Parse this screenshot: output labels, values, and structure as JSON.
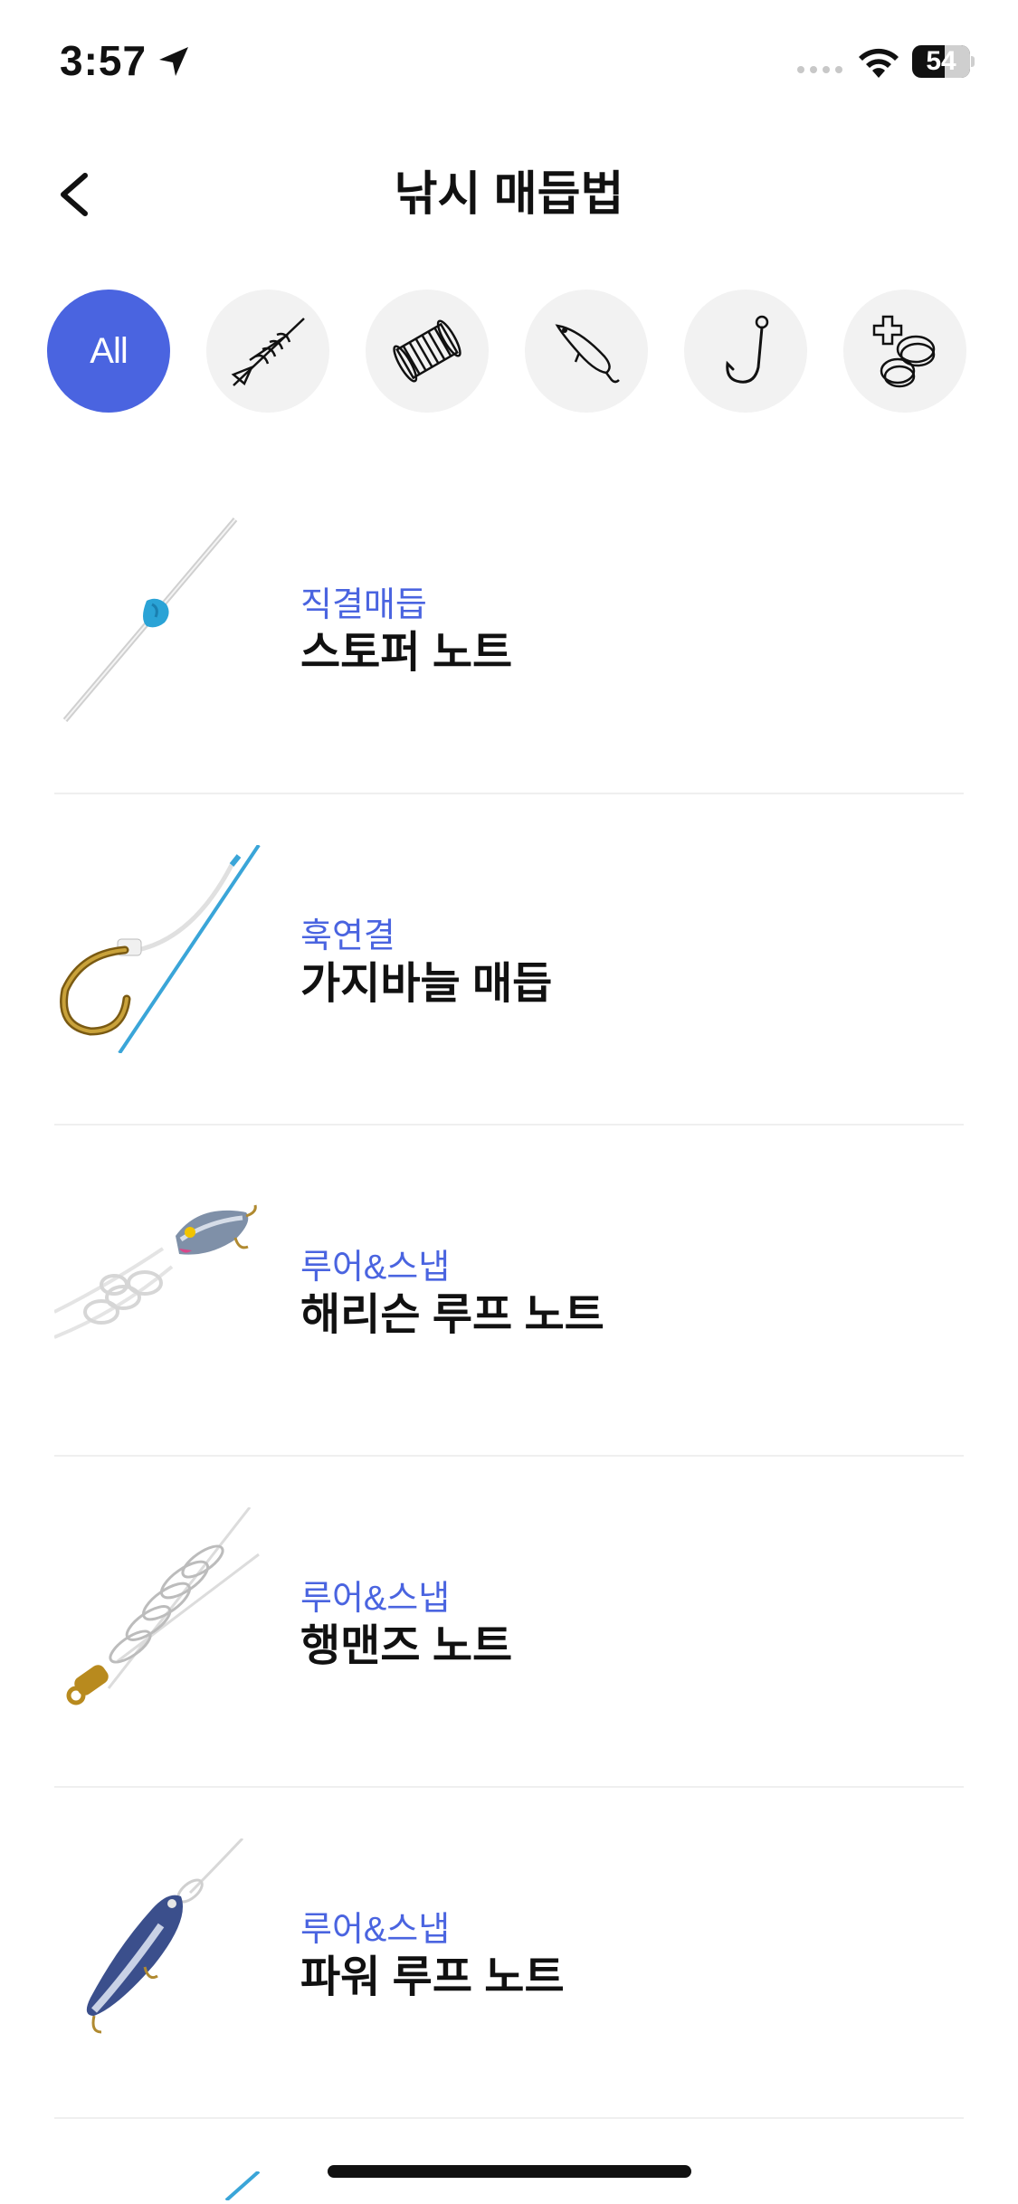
{
  "status_bar": {
    "time": "3:57",
    "battery": "54",
    "icons": [
      "location-arrow-icon",
      "signal-dots-icon",
      "wifi-icon",
      "battery-icon"
    ]
  },
  "nav": {
    "title": "낚시 매듭법",
    "back_icon": "chevron-left-icon"
  },
  "categories": [
    {
      "label": "All",
      "icon": "",
      "active": true
    },
    {
      "label": "",
      "icon": "line-knot-icon",
      "active": false
    },
    {
      "label": "",
      "icon": "spool-icon",
      "active": false
    },
    {
      "label": "",
      "icon": "lure-icon",
      "active": false
    },
    {
      "label": "",
      "icon": "hook-icon",
      "active": false
    },
    {
      "label": "",
      "icon": "rope-plus-icon",
      "active": false
    }
  ],
  "knots": [
    {
      "category": "직결매듭",
      "name": "스토퍼 노트",
      "thumb": "stopper-knot-image"
    },
    {
      "category": "훅연결",
      "name": "가지바늘 매듭",
      "thumb": "dropper-hook-image"
    },
    {
      "category": "루어&스냅",
      "name": "해리슨 루프 노트",
      "thumb": "harrison-loop-image"
    },
    {
      "category": "루어&스냅",
      "name": "행맨즈 노트",
      "thumb": "hangman-knot-image"
    },
    {
      "category": "루어&스냅",
      "name": "파워 루프 노트",
      "thumb": "power-loop-image"
    }
  ],
  "colors": {
    "accent": "#4a64e0",
    "category_bg": "#f2f2f2",
    "divider": "#efefef"
  }
}
